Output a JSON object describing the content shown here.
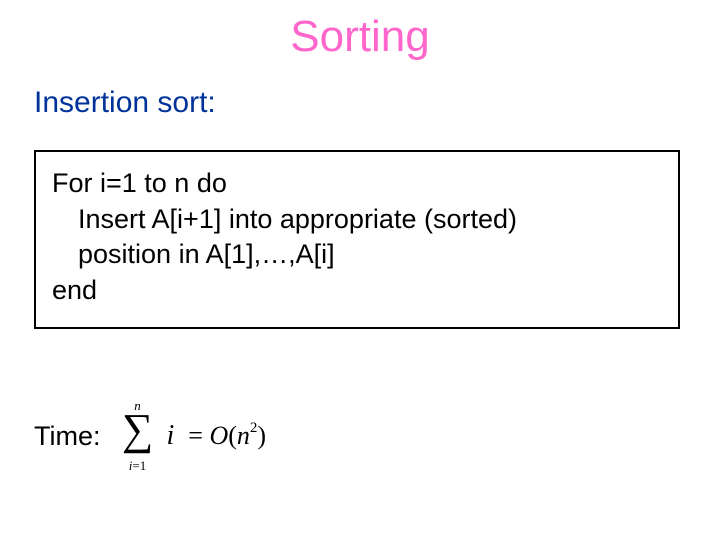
{
  "title": "Sorting",
  "subtitle": "Insertion sort:",
  "pseudocode": {
    "line1": "For i=1 to n do",
    "line2": "Insert A[i+1] into appropriate (sorted)",
    "line3": "position in A[1],…,A[i]",
    "line4": "end"
  },
  "time": {
    "label": "Time:",
    "sum": {
      "upper": "n",
      "sigma": "∑",
      "lower_var": "i",
      "lower_eq": "=",
      "lower_from": "1",
      "variable": "i"
    },
    "eq": {
      "equals": "=",
      "space": " ",
      "O": "O",
      "open": "(",
      "n": "n",
      "exp": "2",
      "close": ")"
    }
  }
}
